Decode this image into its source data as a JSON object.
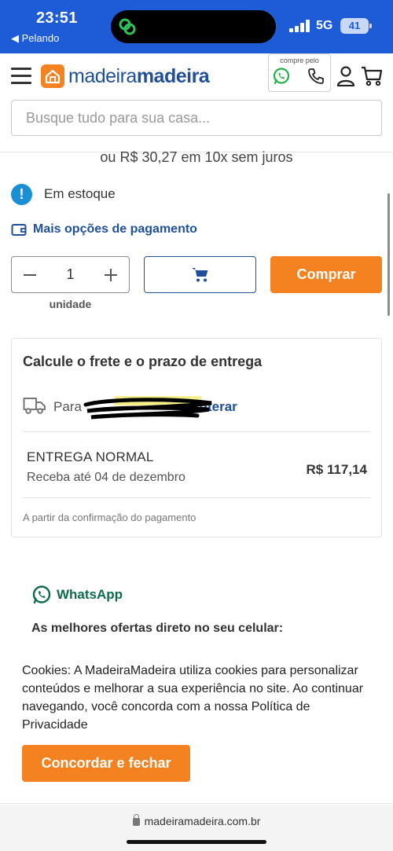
{
  "status_bar": {
    "time": "23:51",
    "back_app": "◀ Pelando",
    "network": "5G",
    "battery": "41"
  },
  "header": {
    "logo_text": "madeiramadeira",
    "buy_via_label": "compre pelo",
    "search_placeholder": "Busque tudo para sua casa..."
  },
  "product": {
    "installments": "ou R$ 30,27 em 10x sem juros",
    "stock_status": "Em estoque",
    "more_payment_options": "Mais opções de pagamento",
    "quantity": "1",
    "quantity_unit": "unidade",
    "buy_label": "Comprar"
  },
  "shipping": {
    "title": "Calcule o frete e o prazo de entrega",
    "to_label": "Para",
    "change_label": "Alterar",
    "method": "ENTREGA NORMAL",
    "estimate": "Receba até 04 de dezembro",
    "price": "R$ 117,14",
    "note": "A partir da confirmação do pagamento"
  },
  "whatsapp": {
    "name": "WhatsApp",
    "tagline": "As melhores ofertas direto no seu celular:"
  },
  "cookie_banner": {
    "text": "Cookies: A MadeiraMadeira utiliza cookies para personalizar conteúdos e melhorar a sua experiência no site. Ao continuar navegando, você concorda com a nossa Política de Privacidade",
    "accept_label": "Concordar e fechar"
  },
  "browser": {
    "url": "madeiramadeira.com.br"
  },
  "colors": {
    "status_bar": "#1e5bd6",
    "brand_blue": "#1f4f99",
    "brand_orange": "#f58220",
    "whatsapp_green": "#0f6b4d",
    "info_blue": "#1a8fd6"
  }
}
